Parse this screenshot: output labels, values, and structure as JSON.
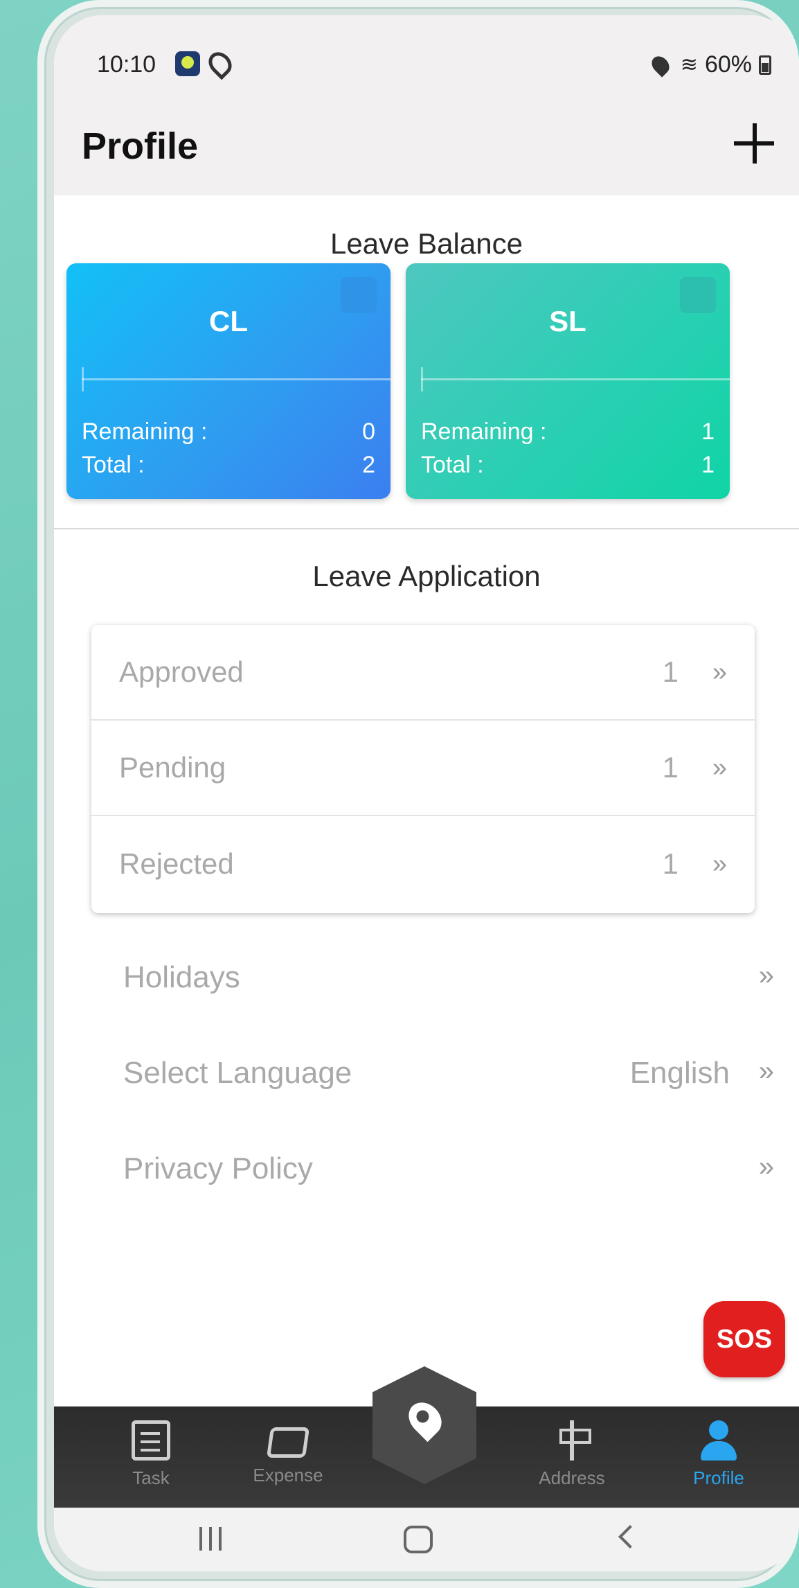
{
  "status_bar": {
    "time": "10:10",
    "battery": "60%"
  },
  "header": {
    "title": "Profile"
  },
  "leave_balance": {
    "title": "Leave Balance",
    "cards": [
      {
        "name": "CL",
        "remaining_label": "Remaining :",
        "remaining": "0",
        "total_label": "Total :",
        "total": "2"
      },
      {
        "name": "SL",
        "remaining_label": "Remaining :",
        "remaining": "1",
        "total_label": "Total :",
        "total": "1"
      }
    ]
  },
  "leave_application": {
    "title": "Leave Application",
    "rows": [
      {
        "label": "Approved",
        "count": "1"
      },
      {
        "label": "Pending",
        "count": "1"
      },
      {
        "label": "Rejected",
        "count": "1"
      }
    ]
  },
  "menu": [
    {
      "label": "Holidays",
      "value": ""
    },
    {
      "label": "Select Language",
      "value": "English"
    },
    {
      "label": "Privacy Policy",
      "value": ""
    }
  ],
  "chevron": "»",
  "sos_label": "SOS",
  "bottom_nav": [
    {
      "label": "Task",
      "icon": "task-icon"
    },
    {
      "label": "Expense",
      "icon": "wallet-icon"
    },
    {
      "label": "Address",
      "icon": "signpost-icon"
    },
    {
      "label": "Profile",
      "icon": "person-icon",
      "active": true
    }
  ],
  "colors": {
    "accent": "#2aa5f0",
    "sos": "#e21f1f",
    "cl_card": "#12c0f7",
    "sl_card": "#10d4a6"
  }
}
